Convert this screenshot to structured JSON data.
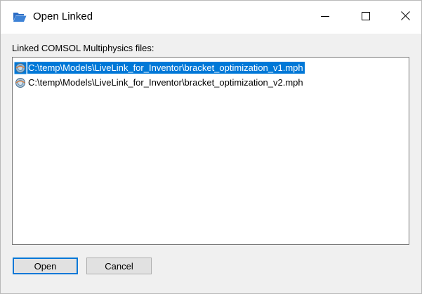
{
  "window": {
    "title": "Open Linked",
    "title_icon": "folder-open-icon",
    "controls": {
      "minimize_icon": "minimize-icon",
      "maximize_icon": "maximize-icon",
      "close_icon": "close-icon"
    }
  },
  "files": {
    "label": "Linked COMSOL Multiphysics files:",
    "items": [
      {
        "path": "C:\\temp\\Models\\LiveLink_for_Inventor\\bracket_optimization_v1.mph",
        "selected": true,
        "icon": "comsol-file-icon"
      },
      {
        "path": "C:\\temp\\Models\\LiveLink_for_Inventor\\bracket_optimization_v2.mph",
        "selected": false,
        "icon": "comsol-file-icon"
      }
    ]
  },
  "buttons": {
    "open_label": "Open",
    "cancel_label": "Cancel"
  },
  "colors": {
    "selection": "#0078d7",
    "titlebar": "#ffffff",
    "dialog_bg": "#f0f0f0",
    "folder_icon": "#2b6cc4"
  }
}
